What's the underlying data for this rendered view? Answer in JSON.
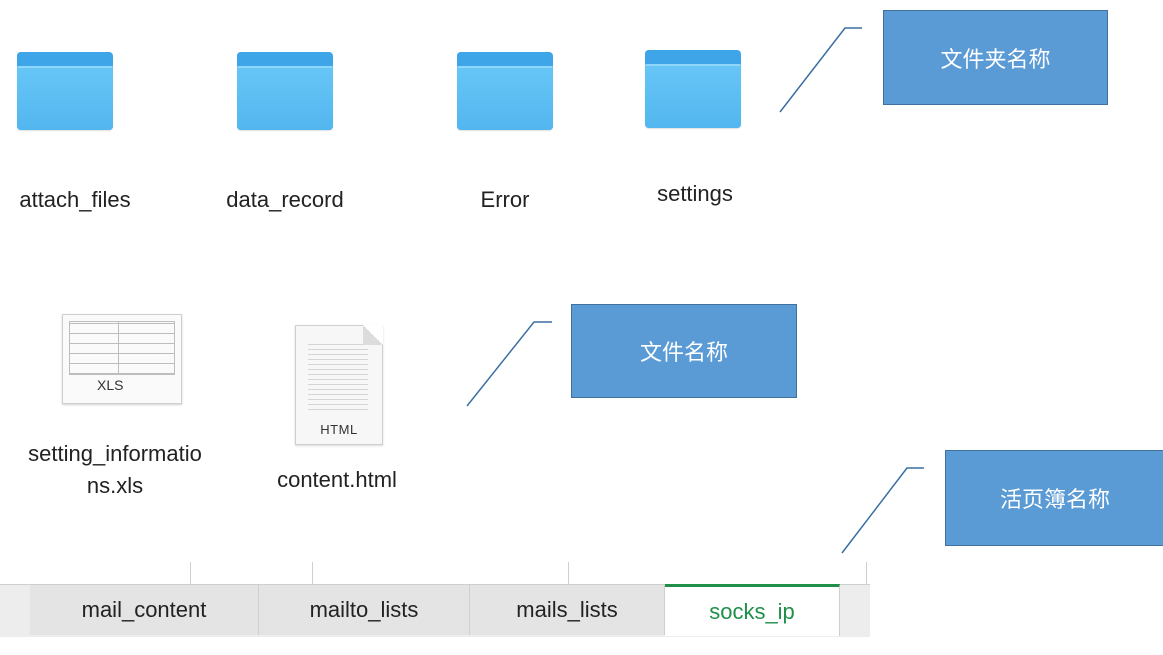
{
  "folders": [
    {
      "name": "attach_files"
    },
    {
      "name": "data_record"
    },
    {
      "name": "Error"
    },
    {
      "name": "settings"
    }
  ],
  "files": [
    {
      "name": "setting_informatio\nns.xls",
      "icon": "xls-file-icon",
      "badge": "XLS"
    },
    {
      "name": "content.html",
      "icon": "html-file-icon",
      "badge": "HTML"
    }
  ],
  "callouts": {
    "folder_name": "文件夹名称",
    "file_name": "文件名称",
    "sheet_name": "活页簿名称"
  },
  "sheets": [
    {
      "label": "mail_content",
      "active": false
    },
    {
      "label": "mailto_lists",
      "active": false
    },
    {
      "label": "mails_lists",
      "active": false
    },
    {
      "label": "socks_ip",
      "active": true
    }
  ],
  "colors": {
    "folder": "#53b6ef",
    "callout": "#5b9bd5",
    "active_sheet": "#1f8f4a"
  }
}
